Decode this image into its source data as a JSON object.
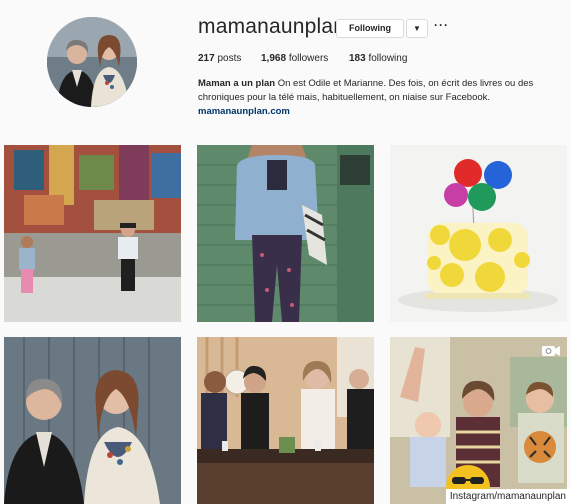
{
  "profile": {
    "username": "mamanaunplan",
    "follow_label": "Following",
    "dropdown_icon": "chevron-down-icon",
    "more_icon": "more-horizontal-icon",
    "more_label": "···",
    "stats": {
      "posts_count": "217",
      "posts_label": "posts",
      "followers_count": "1,968",
      "followers_label": "followers",
      "following_count": "183",
      "following_label": "following"
    },
    "bio": {
      "name": "Maman a un plan",
      "text": "On est Odile et Marianne. Des fois, on écrit des livres ou des chroniques pour la télé mais, habituellement, on niaise sur Facebook."
    },
    "website": "mamanaunplan.com"
  },
  "posts": [
    {
      "subject": "children at mural wall"
    },
    {
      "subject": "woman in denim jacket"
    },
    {
      "subject": "cake with balloons"
    },
    {
      "subject": "two women portrait"
    },
    {
      "subject": "tv show hosts"
    },
    {
      "subject": "family selfie",
      "video_icon": "video-camera-icon"
    }
  ],
  "watermark": "Instagram/mamanaunplan",
  "colors": {
    "link": "#003569",
    "text": "#262626",
    "border": "#dbdbdb"
  }
}
